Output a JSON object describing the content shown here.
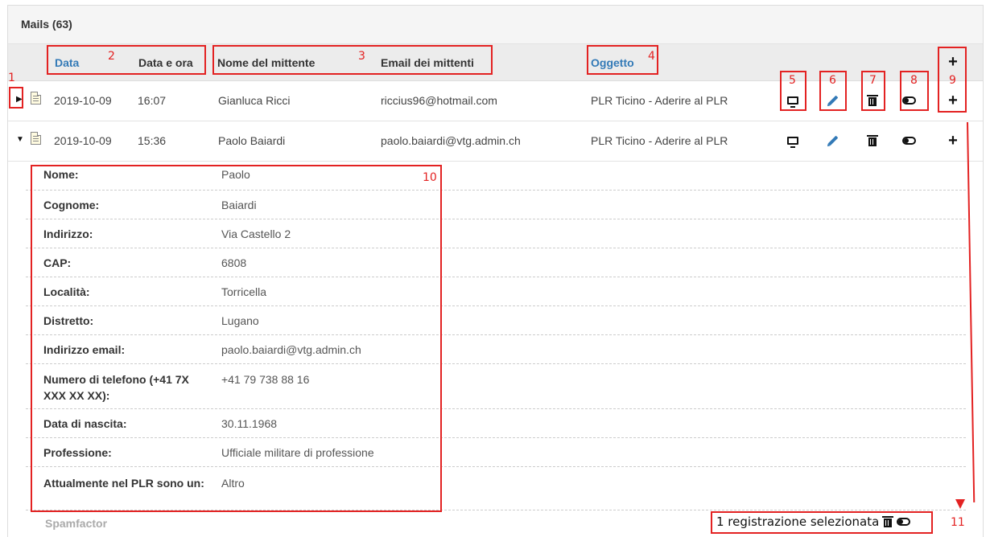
{
  "panel": {
    "title": "Mails (63)"
  },
  "columns": {
    "date": "Data",
    "datetime": "Data e ora",
    "sender_name": "Nome del mittente",
    "sender_email": "Email dei mittenti",
    "subject": "Oggetto"
  },
  "rows": [
    {
      "date": "2019-10-09",
      "time": "16:07",
      "name": "Gianluca Ricci",
      "email": "riccius96@hotmail.com",
      "subject": "PLR Ticino - Aderire al PLR",
      "expanded": false
    },
    {
      "date": "2019-10-09",
      "time": "15:36",
      "name": "Paolo Baiardi",
      "email": "paolo.baiardi@vtg.admin.ch",
      "subject": "PLR Ticino - Aderire al PLR",
      "expanded": true
    }
  ],
  "details": [
    {
      "label": "Nome:",
      "value": "Paolo"
    },
    {
      "label": "Cognome:",
      "value": "Baiardi"
    },
    {
      "label": "Indirizzo:",
      "value": "Via Castello 2"
    },
    {
      "label": "CAP:",
      "value": "6808"
    },
    {
      "label": "Località:",
      "value": "Torricella"
    },
    {
      "label": "Distretto:",
      "value": "Lugano"
    },
    {
      "label": "Indirizzo email:",
      "value": "paolo.baiardi@vtg.admin.ch"
    },
    {
      "label": "Numero di telefono (+41 7X XXX XX XX):",
      "value": "+41 79 738 88 16"
    },
    {
      "label": "Data di nascita:",
      "value": "30.11.1968"
    },
    {
      "label": "Professione:",
      "value": "Ufficiale militare di professione"
    },
    {
      "label": "Attualmente nel PLR sono un:",
      "value": "Altro"
    }
  ],
  "spamfactor": "Spamfactor",
  "selection": {
    "text": "1 registrazione selezionata"
  },
  "annotations": [
    "1",
    "2",
    "3",
    "4",
    "5",
    "6",
    "7",
    "8",
    "9",
    "10",
    "11"
  ],
  "icons": {
    "expand": "triangle-right-icon",
    "collapse": "triangle-down-icon",
    "file": "file-icon",
    "view": "monitor-icon",
    "edit": "pencil-icon",
    "delete": "trash-icon",
    "toggle": "toggle-icon",
    "add": "plus-icon"
  },
  "colors": {
    "link": "#337ab7",
    "annotation": "#e32222",
    "header_bg": "#ececec"
  }
}
